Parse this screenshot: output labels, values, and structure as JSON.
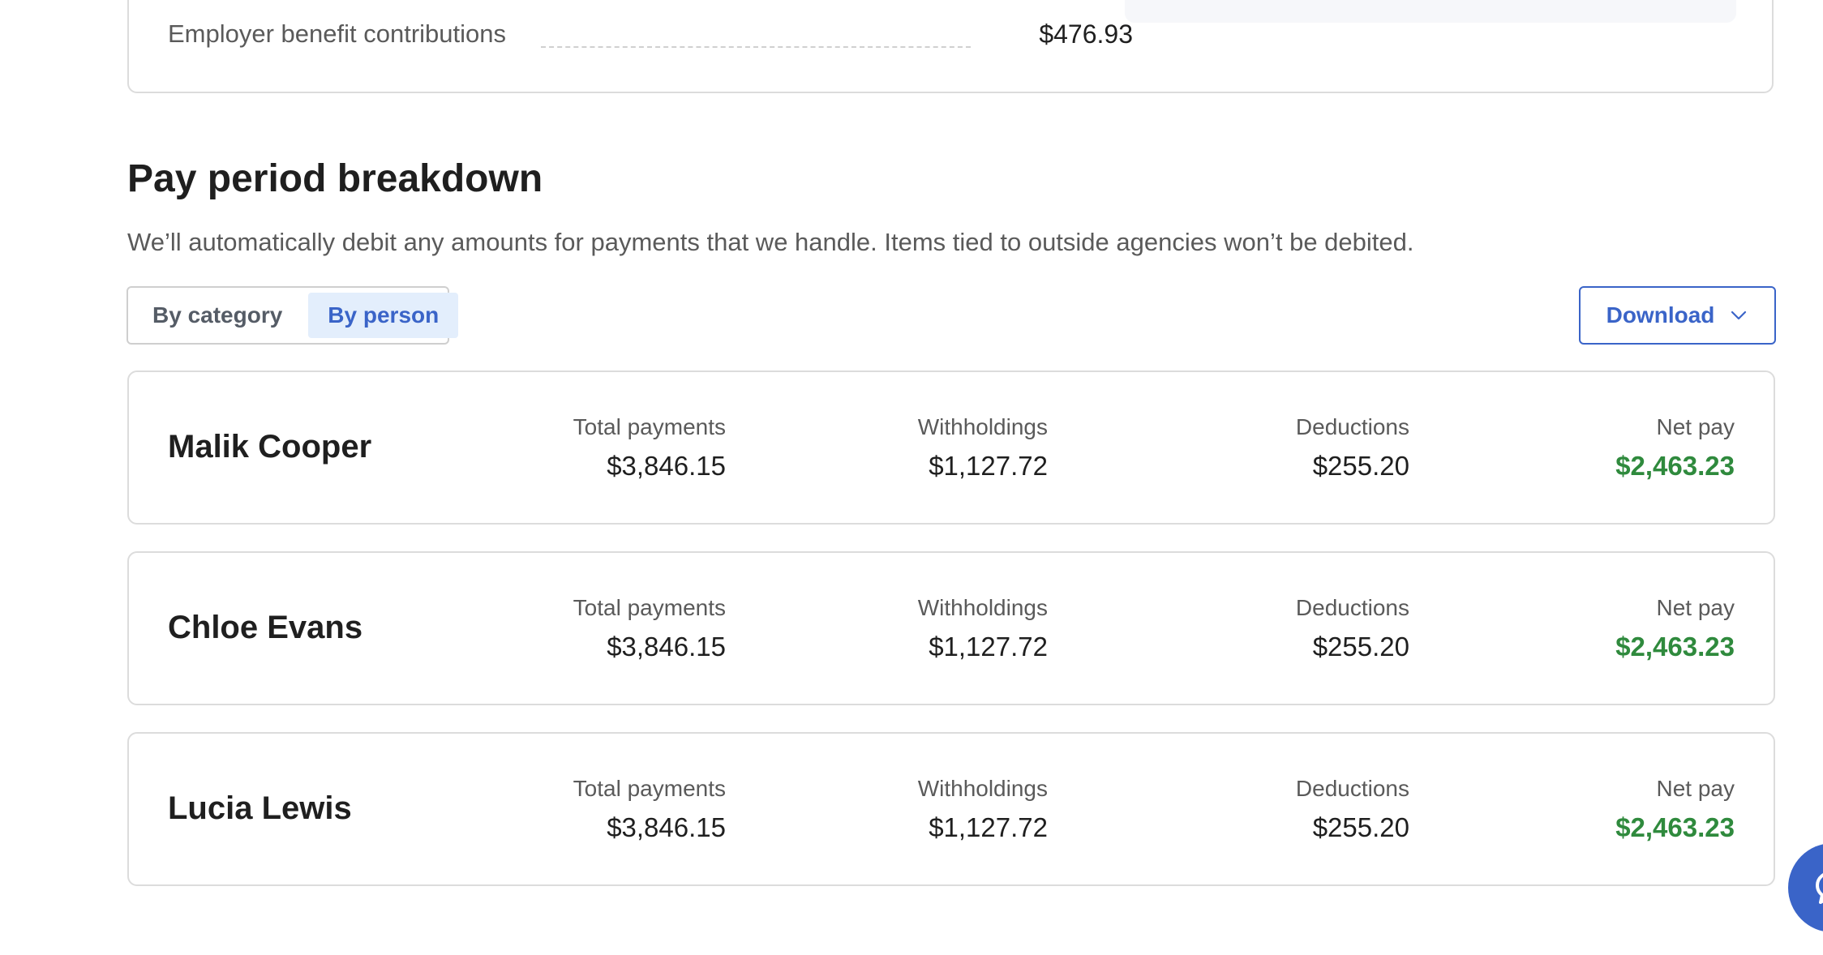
{
  "summary": {
    "label": "Employer benefit contributions",
    "value": "$476.93"
  },
  "section": {
    "title": "Pay period breakdown",
    "description": "We’ll automatically debit any amounts for payments that we handle. Items tied to outside agencies won’t be debited."
  },
  "toggle": {
    "options": [
      {
        "label": "By category",
        "selected": false
      },
      {
        "label": "By person",
        "selected": true
      }
    ]
  },
  "download": {
    "label": "Download",
    "icon": "chevron-down-icon"
  },
  "columns": {
    "total_payments": "Total payments",
    "withholdings": "Withholdings",
    "deductions": "Deductions",
    "net_pay": "Net pay"
  },
  "people": [
    {
      "name": "Malik Cooper",
      "total_payments": "$3,846.15",
      "withholdings": "$1,127.72",
      "deductions": "$255.20",
      "net_pay": "$2,463.23"
    },
    {
      "name": "Chloe Evans",
      "total_payments": "$3,846.15",
      "withholdings": "$1,127.72",
      "deductions": "$255.20",
      "net_pay": "$2,463.23"
    },
    {
      "name": "Lucia Lewis",
      "total_payments": "$3,846.15",
      "withholdings": "$1,127.72",
      "deductions": "$255.20",
      "net_pay": "$2,463.23"
    }
  ],
  "colors": {
    "accent": "#3a64c8",
    "net_pay": "#2f8a3d",
    "toggle_active_bg": "#e3eefc"
  },
  "chat": {
    "icon": "chat-icon"
  }
}
